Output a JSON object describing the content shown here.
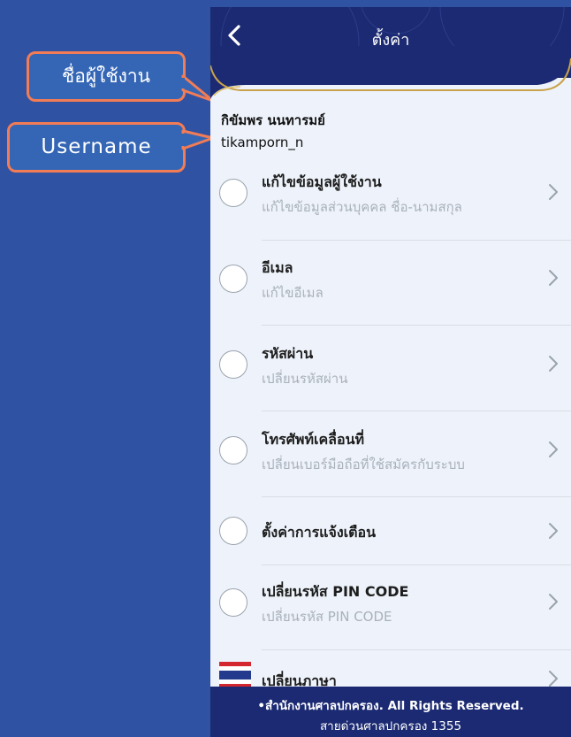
{
  "header": {
    "title": "ตั้งค่า",
    "back_icon": "chevron-left-icon"
  },
  "user": {
    "full_name": "กิขัมพร นนทารมย์",
    "username": "tikamporn_n"
  },
  "annotations": {
    "name_label": "ชื่อผู้ใช้งาน",
    "username_label": "Username"
  },
  "menu": {
    "items": [
      {
        "title": "แก้ไขข้อมูลผู้ใช้งาน",
        "subtitle": "แก้ไขข้อมูลส่วนบุคคล ชื่อ-นามสกุล"
      },
      {
        "title": "อีเมล",
        "subtitle": "แก้ไขอีเมล"
      },
      {
        "title": "รหัสผ่าน",
        "subtitle": "เปลี่ยนรหัสผ่าน"
      },
      {
        "title": "โทรศัพท์เคลื่อนที่",
        "subtitle": "เปลี่ยนเบอร์มือถือที่ใช้สมัครกับระบบ"
      },
      {
        "title": "ตั้งค่าการแจ้งเตือน",
        "subtitle": ""
      },
      {
        "title": "เปลี่ยนรหัส PIN CODE",
        "subtitle": "เปลี่ยนรหัส PIN CODE"
      },
      {
        "title": "เปลี่ยนภาษา",
        "subtitle": ""
      }
    ]
  },
  "footer": {
    "copyright": "•สำนักงานศาลปกครอง. All Rights Reserved.",
    "hotline": "สายด่วนศาลปกครอง 1355"
  },
  "colors": {
    "background": "#2f52a3",
    "header": "#1b2a72",
    "content": "#eef3fb",
    "gold_accent": "#c9a24a",
    "callout_fill": "#3466b5",
    "callout_border": "#f27c55"
  }
}
